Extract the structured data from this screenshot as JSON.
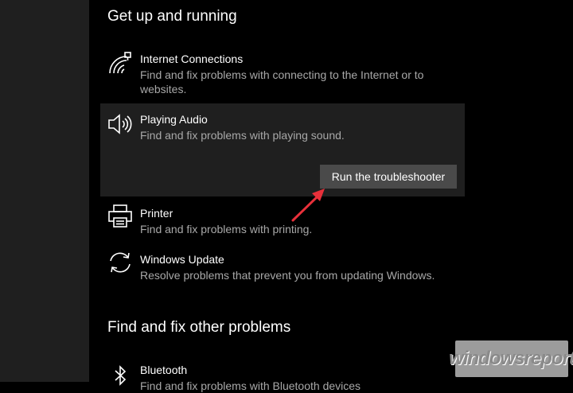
{
  "sections": {
    "get_up": "Get up and running",
    "other": "Find and fix other problems"
  },
  "items": {
    "internet": {
      "title": "Internet Connections",
      "desc": "Find and fix problems with connecting to the Internet or to websites."
    },
    "audio": {
      "title": "Playing Audio",
      "desc": "Find and fix problems with playing sound.",
      "button": "Run the troubleshooter"
    },
    "printer": {
      "title": "Printer",
      "desc": "Find and fix problems with printing."
    },
    "update": {
      "title": "Windows Update",
      "desc": "Resolve problems that prevent you from updating Windows."
    },
    "bluetooth": {
      "title": "Bluetooth",
      "desc": "Find and fix problems with Bluetooth devices"
    }
  },
  "watermark": "windowsreport",
  "colors": {
    "background": "#000000",
    "sidebar": "#1f1f1f",
    "selected_item": "#1f1f1f",
    "button": "#4a4a4a",
    "description_text": "#a8a8a8",
    "arrow": "#e8303a"
  },
  "icons": {
    "internet": "wifi-network-icon",
    "audio": "speaker-icon",
    "printer": "printer-icon",
    "update": "sync-icon",
    "bluetooth": "bluetooth-icon"
  }
}
